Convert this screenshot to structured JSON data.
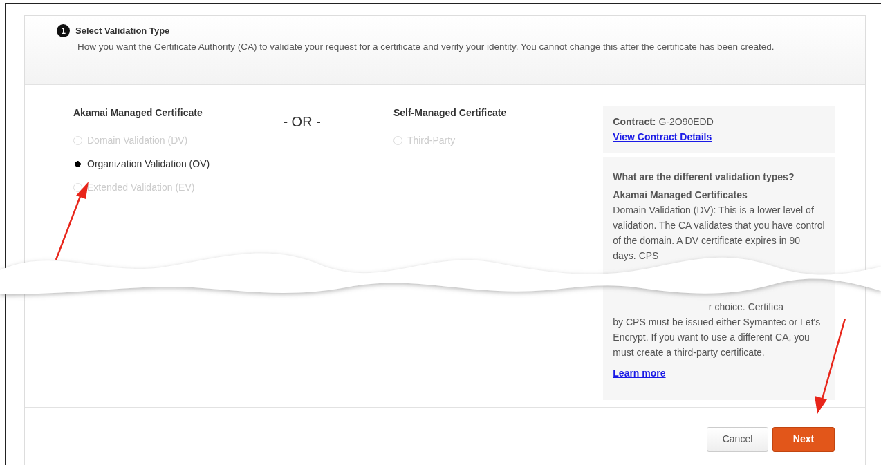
{
  "step": {
    "number": "1",
    "title": "Select Validation Type",
    "description": "How you want the Certificate Authority (CA) to validate your request for a certificate and verify your identity. You cannot change this after the certificate has been created."
  },
  "managed": {
    "heading": "Akamai Managed Certificate",
    "options": [
      {
        "label": "Domain Validation (DV)",
        "selected": false,
        "disabled": true
      },
      {
        "label": "Organization Validation (OV)",
        "selected": true,
        "disabled": false
      },
      {
        "label": "Extended Validation (EV)",
        "selected": false,
        "disabled": true
      }
    ]
  },
  "separator": "- OR -",
  "self_managed": {
    "heading": "Self-Managed Certificate",
    "options": [
      {
        "label": "Third-Party",
        "selected": false,
        "disabled": true
      }
    ]
  },
  "contract": {
    "label": "Contract:",
    "value": "G-2O90EDD",
    "link": "View Contract Details"
  },
  "info": {
    "question": "What are the different validation types?",
    "heading": "Akamai Managed Certificates",
    "text_before_tear": "Domain Validation (DV): This is a lower level of validation. The CA validates that you have control of the domain. A DV certificate expires in 90 days. CPS",
    "fragment_after_tear": "r choice. Certifica",
    "text_after_tear": "by CPS must be issued either Symantec or Let's Encrypt. If you want to use a different CA, you must create a third-party certificate.",
    "link": "Learn more"
  },
  "buttons": [
    {
      "label": "Cancel",
      "kind": "secondary"
    },
    {
      "label": "Next",
      "kind": "primary"
    }
  ]
}
